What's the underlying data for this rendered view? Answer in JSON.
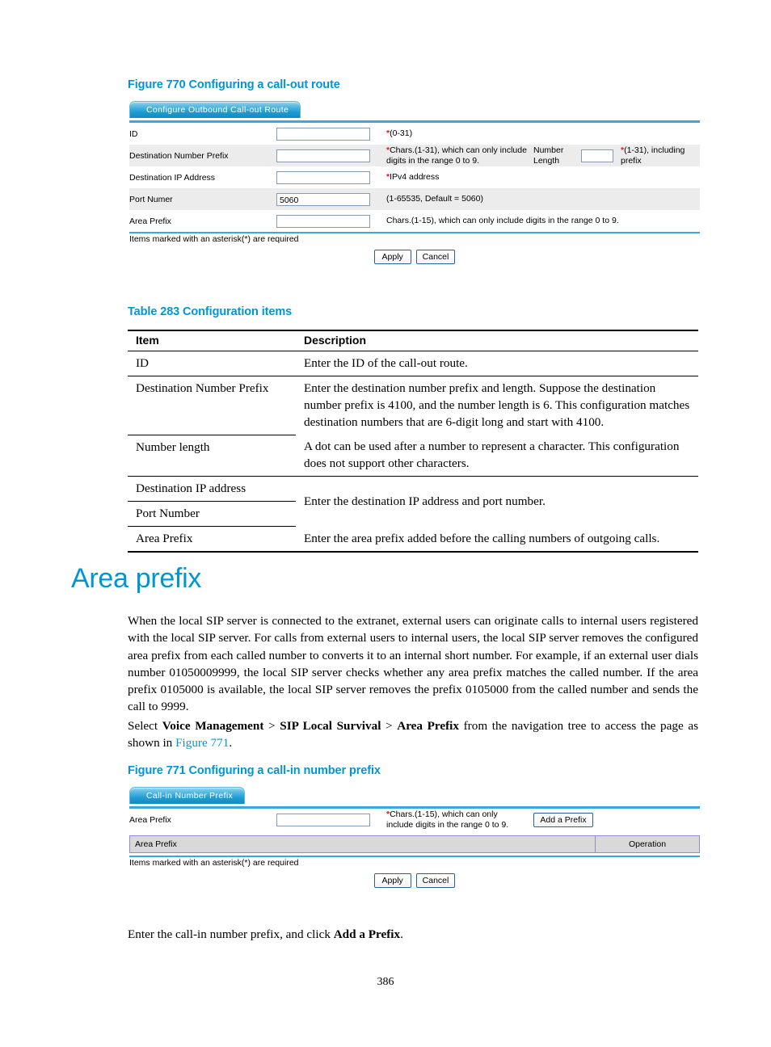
{
  "figure770": {
    "caption": "Figure 770 Configuring a call-out route",
    "tab_label": "Configure Outbound Call-out Route",
    "rows": [
      {
        "label": "ID",
        "value": "",
        "hint_star": "*",
        "hint": "(0-31)"
      },
      {
        "label": "Destination Number Prefix",
        "value": "",
        "hint_star": "*",
        "hint": "Chars.(1-31), which can only include digits in the range 0 to 9.",
        "extra_label": "Number Length",
        "extra_value": "",
        "extra_hint_star": "*",
        "extra_hint": "(1-31), including prefix"
      },
      {
        "label": "Destination IP Address",
        "value": "",
        "hint_star": "*",
        "hint": "IPv4 address"
      },
      {
        "label": "Port Numer",
        "value": "5060",
        "hint_star": "",
        "hint": "(1-65535, Default = 5060)"
      },
      {
        "label": "Area Prefix",
        "value": "",
        "hint_star": "",
        "hint": "Chars.(1-15), which can only include digits in the range 0 to 9."
      }
    ],
    "footnote": "Items marked with an asterisk(*) are required",
    "apply_label": "Apply",
    "cancel_label": "Cancel"
  },
  "table283": {
    "caption": "Table 283 Configuration items",
    "headers": [
      "Item",
      "Description"
    ],
    "rows": [
      {
        "item": "ID",
        "description": "Enter the ID of the call-out route."
      },
      {
        "item": "Destination Number Prefix",
        "description": "Enter the destination number prefix and length. Suppose the destination number prefix is 4100, and the number length is 6.  This configuration matches destination numbers that are 6-digit long and start with 4100."
      },
      {
        "item": "Number length",
        "description": "A dot can be used after a number to represent a character. This configuration does not support other characters."
      },
      {
        "item": "Destination IP address",
        "description": "Enter the destination IP address and port number."
      },
      {
        "item": "Port Number",
        "description": ""
      },
      {
        "item": "Area Prefix",
        "description": "Enter the area prefix added before the calling numbers of outgoing calls."
      }
    ]
  },
  "section": {
    "title": "Area prefix",
    "paragraph1": "When the local SIP server is connected to the extranet, external users can originate calls to internal users registered with the local SIP server. For calls from external users to internal users, the local SIP server removes the configured area prefix from each called number to converts it to an internal short number. For example, if an external user dials number 01050009999, the local SIP server checks whether any area prefix matches the called number. If the area prefix 0105000 is available, the local SIP server removes the prefix 0105000 from the called number and sends the call to 9999.",
    "paragraph2": {
      "prefix": "Select ",
      "bold1": "Voice Management",
      "sep1": " > ",
      "bold2": "SIP Local Survival",
      "sep2": " > ",
      "bold3": "Area Prefix",
      "middle": " from the navigation tree to access the page as shown in ",
      "link": "Figure 771",
      "suffix": "."
    }
  },
  "figure771": {
    "caption": "Figure 771 Configuring a call-in number prefix",
    "tab_label": "Call-in Number Prefix",
    "field_label": "Area Prefix",
    "field_value": "",
    "hint_star": "*",
    "hint": "Chars.(1-15), which can only include digits in the range 0 to 9.",
    "add_button_label": "Add a Prefix",
    "list_header_col1": "Area Prefix",
    "list_header_col2": "Operation",
    "footnote": "Items marked with an asterisk(*) are required",
    "apply_label": "Apply",
    "cancel_label": "Cancel"
  },
  "closing": {
    "prefix": "Enter the call-in number prefix, and click ",
    "bold": "Add a Prefix",
    "suffix": "."
  },
  "page_number": "386",
  "colors": {
    "heading_blue": "#0096d6",
    "required_red": "#e8131a",
    "tab_blue": "#1f9ed4",
    "row_shade": "#ececec"
  }
}
